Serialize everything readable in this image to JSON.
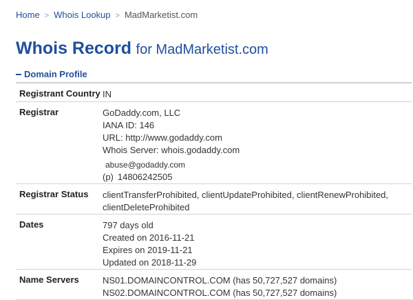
{
  "breadcrumb": {
    "home": "Home",
    "lookup": "Whois Lookup",
    "current": "MadMarketist.com",
    "sep": ">"
  },
  "header": {
    "title": "Whois Record",
    "subtitle": "for MadMarketist.com"
  },
  "section": {
    "label": "Domain Profile"
  },
  "profile": {
    "country": {
      "label": "Registrant Country",
      "value": "IN"
    },
    "registrar": {
      "label": "Registrar",
      "name": "GoDaddy.com, LLC",
      "iana": "IANA ID: 146",
      "url": "URL: http://www.godaddy.com",
      "whois_server": "Whois Server: whois.godaddy.com",
      "email": "abuse@godaddy.com",
      "phone_label": "(p)",
      "phone": "14806242505"
    },
    "status": {
      "label": "Registrar Status",
      "line1": "clientTransferProhibited, clientUpdateProhibited, clientRenewProhibited,",
      "line2": "clientDeleteProhibited"
    },
    "dates": {
      "label": "Dates",
      "age": "797 days old",
      "created": "Created on 2016-11-21",
      "expires": "Expires on 2019-11-21",
      "updated": "Updated on 2018-11-29"
    },
    "name_servers": {
      "label": "Name Servers",
      "ns1": "NS01.DOMAINCONTROL.COM (has 50,727,527 domains)",
      "ns2": "NS02.DOMAINCONTROL.COM (has 50,727,527 domains)"
    }
  }
}
